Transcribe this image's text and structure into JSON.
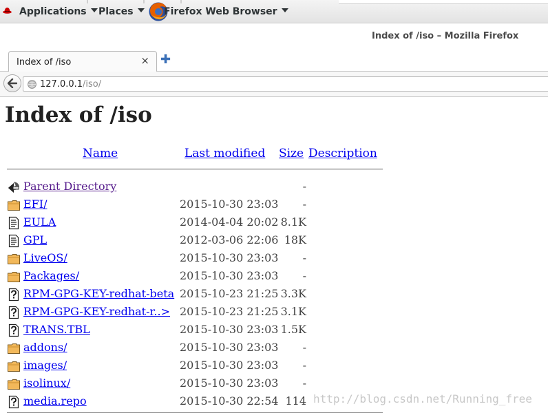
{
  "panel": {
    "applications_label": "Applications",
    "places_label": "Places",
    "firefox_label": "Firefox Web Browser"
  },
  "window": {
    "title": "Index of /iso – Mozilla Firefox"
  },
  "tab": {
    "label": "Index of /iso",
    "close_glyph": "×",
    "new_tab_glyph": "✚"
  },
  "urlbar": {
    "host": "127.0.0.1",
    "path": "/iso/"
  },
  "page": {
    "heading": "Index of /iso",
    "columns": {
      "name": "Name",
      "last_modified": "Last modified",
      "size": "Size",
      "description": "Description"
    },
    "rows": [
      {
        "name": "Parent Directory",
        "date": "",
        "size": "-",
        "icon": "back-arrow-icon"
      },
      {
        "name": "EFI/",
        "date": "2015-10-30 23:03",
        "size": "-",
        "icon": "folder-icon"
      },
      {
        "name": "EULA",
        "date": "2014-04-04 20:02",
        "size": "8.1K",
        "icon": "text-file-icon"
      },
      {
        "name": "GPL",
        "date": "2012-03-06 22:06",
        "size": "18K",
        "icon": "text-file-icon"
      },
      {
        "name": "LiveOS/",
        "date": "2015-10-30 23:03",
        "size": "-",
        "icon": "folder-icon"
      },
      {
        "name": "Packages/",
        "date": "2015-10-30 23:03",
        "size": "-",
        "icon": "folder-icon"
      },
      {
        "name": "RPM-GPG-KEY-redhat-beta",
        "date": "2015-10-23 21:25",
        "size": "3.3K",
        "icon": "unknown-file-icon"
      },
      {
        "name": "RPM-GPG-KEY-redhat-r..>",
        "date": "2015-10-23 21:25",
        "size": "3.1K",
        "icon": "unknown-file-icon"
      },
      {
        "name": "TRANS.TBL",
        "date": "2015-10-30 23:03",
        "size": "1.5K",
        "icon": "unknown-file-icon"
      },
      {
        "name": "addons/",
        "date": "2015-10-30 23:03",
        "size": "-",
        "icon": "folder-icon"
      },
      {
        "name": "images/",
        "date": "2015-10-30 23:03",
        "size": "-",
        "icon": "folder-icon"
      },
      {
        "name": "isolinux/",
        "date": "2015-10-30 23:03",
        "size": "-",
        "icon": "folder-icon"
      },
      {
        "name": "media.repo",
        "date": "2015-10-30 22:54",
        "size": "114",
        "icon": "unknown-file-icon"
      }
    ]
  },
  "watermark": "http://blog.csdn.net/Running_free"
}
